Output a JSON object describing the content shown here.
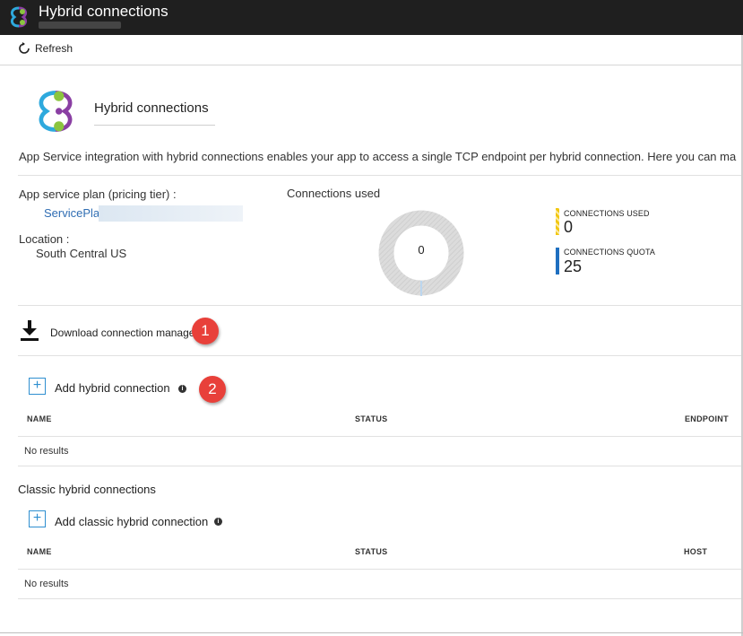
{
  "window": {
    "title": "Hybrid connections"
  },
  "toolbar": {
    "refresh_label": "Refresh"
  },
  "hero": {
    "title": "Hybrid connections"
  },
  "description": "App Service integration with hybrid connections enables your app to access a single TCP endpoint per hybrid connection. Here you can ma",
  "plan": {
    "label": "App service plan (pricing tier) :",
    "value": "ServicePlan"
  },
  "location": {
    "label": "Location :",
    "value": "South Central US"
  },
  "connections": {
    "title": "Connections used",
    "donut_value": "0",
    "used_label": "CONNECTIONS USED",
    "used_value": "0",
    "used_color": "#f2c811",
    "quota_label": "CONNECTIONS QUOTA",
    "quota_value": "25",
    "quota_color": "#1e6fc0",
    "donut_fraction": 0
  },
  "download": {
    "label": "Download connection manager",
    "badge": "1",
    "icon": "download-icon"
  },
  "hybrid": {
    "add_label": "Add hybrid connection",
    "badge": "2",
    "columns": [
      "NAME",
      "STATUS",
      "ENDPOINT"
    ],
    "empty_text": "No results"
  },
  "classic": {
    "title": "Classic hybrid connections",
    "add_label": "Add classic hybrid connection",
    "columns": [
      "NAME",
      "STATUS",
      "HOST"
    ],
    "empty_text": "No results"
  },
  "colors": {
    "accent": "#2f8fd0",
    "link": "#2f6db3",
    "badge": "#e8403a",
    "titlebar": "#1f1f1f"
  }
}
